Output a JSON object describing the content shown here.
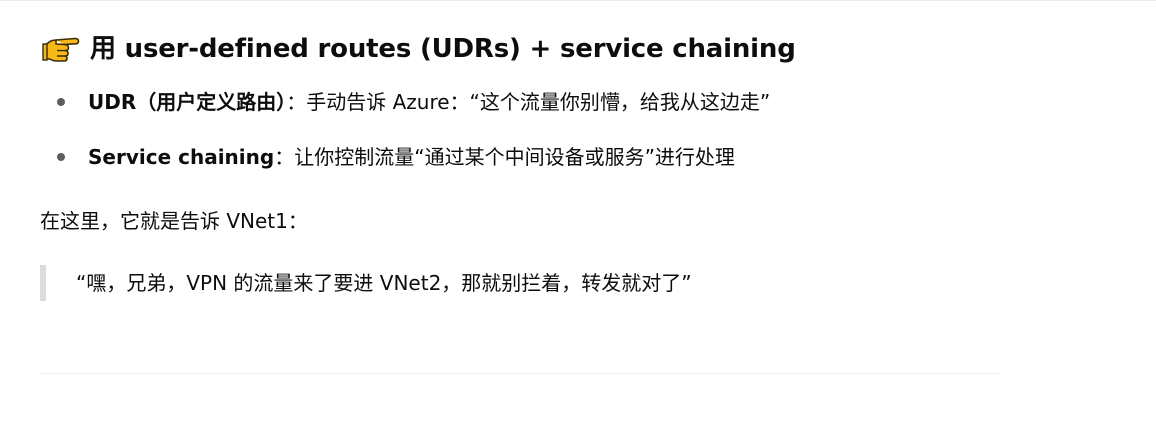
{
  "heading": {
    "icon": "pointing-hand-icon",
    "text": "用 user-defined routes (UDRs) + service chaining"
  },
  "bullets": [
    {
      "term": "UDR（用户定义路由）",
      "text": "：手动告诉 Azure：“这个流量你别懵，给我从这边走”"
    },
    {
      "term": "Service chaining",
      "text": "：让你控制流量“通过某个中间设备或服务”进行处理"
    }
  ],
  "paragraph": "在这里，它就是告诉 VNet1：",
  "quote": "“嘿，兄弟，VPN 的流量来了要进 VNet2，那就别拦着，转发就对了”",
  "colors": {
    "text": "#0d0d0d",
    "bullet": "#5d5d5d",
    "quote_bar": "#dcdcdc",
    "icon_fill": "#f5b919"
  }
}
